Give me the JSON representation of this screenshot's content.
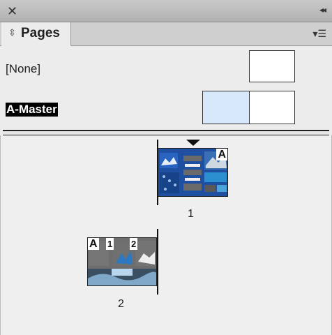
{
  "panel": {
    "close_glyph": "✕",
    "collapse_glyph": "◂◂",
    "tab_label": "Pages",
    "tab_icon": "sort-arrows-icon",
    "menu_icon": "panel-menu-icon"
  },
  "masters": {
    "items": [
      {
        "label": "[None]"
      },
      {
        "label": "A-Master",
        "selected": true
      }
    ]
  },
  "pages": {
    "items": [
      {
        "number": "1",
        "master": "A"
      },
      {
        "number": "2",
        "master": "A"
      }
    ],
    "page2_slot_numbers": [
      "1",
      "2"
    ]
  },
  "colors": {
    "selection_fill": "#d7e8fb",
    "page1_bg": "#1e4fa0"
  }
}
